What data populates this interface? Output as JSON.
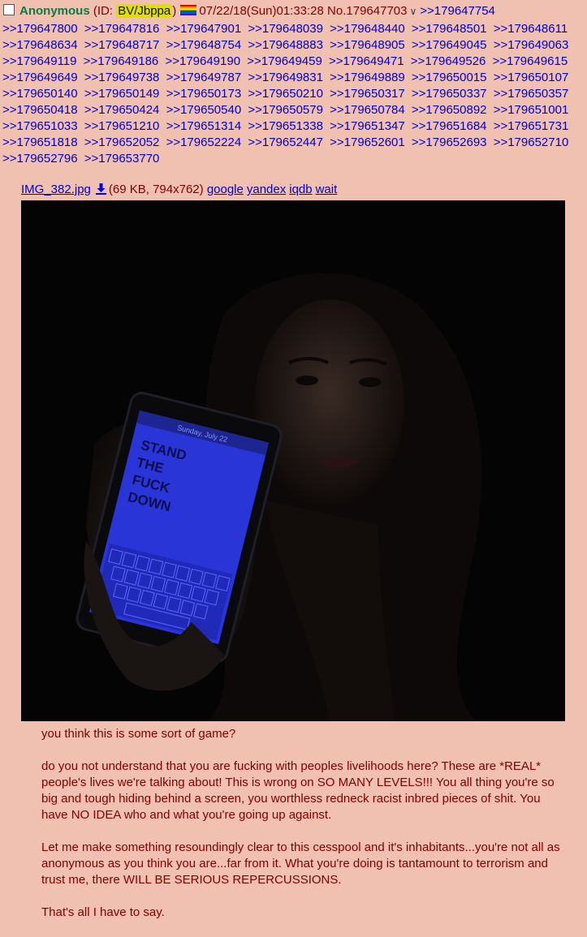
{
  "post": {
    "name": "Anonymous",
    "id_prefix": "(ID: ",
    "id_value": "BV/Jbppa",
    "id_suffix": ")",
    "datetime": "07/22/18(Sun)01:33:28",
    "post_no": "No.179647703",
    "replies": [
      ">>179647754",
      ">>179647800",
      ">>179647816",
      ">>179647901",
      ">>179648039",
      ">>179648440",
      ">>179648501",
      ">>179648611",
      ">>179648634",
      ">>179648717",
      ">>179648754",
      ">>179648883",
      ">>179648905",
      ">>179649045",
      ">>179649063",
      ">>179649119",
      ">>179649186",
      ">>179649190",
      ">>179649459",
      ">>179649471",
      ">>179649526",
      ">>179649615",
      ">>179649649",
      ">>179649738",
      ">>179649787",
      ">>179649831",
      ">>179649889",
      ">>179650015",
      ">>179650107",
      ">>179650140",
      ">>179650149",
      ">>179650173",
      ">>179650210",
      ">>179650317",
      ">>179650337",
      ">>179650357",
      ">>179650418",
      ">>179650424",
      ">>179650540",
      ">>179650579",
      ">>179650784",
      ">>179650892",
      ">>179651001",
      ">>179651033",
      ">>179651210",
      ">>179651314",
      ">>179651338",
      ">>179651347",
      ">>179651684",
      ">>179651731",
      ">>179651818",
      ">>179652052",
      ">>179652224",
      ">>179652447",
      ">>179652601",
      ">>179652693",
      ">>179652710",
      ">>179652796",
      ">>179653770"
    ],
    "file": {
      "name": "IMG_382.jpg",
      "meta": "(69 KB, 794x762)",
      "links": [
        "google",
        "yandex",
        "iqdb",
        "wait"
      ]
    },
    "image_text": [
      "STAND",
      "THE",
      "FUCK",
      "DOWN"
    ],
    "image_status": "Sunday, July 22",
    "comment": [
      "you think this is some sort of game?",
      "do you not understand that you are fucking with peoples livelihoods here? These are *REAL* people's lives we're talking about! This is wrong on SO MANY LEVELS!!! You all thing you're so big and tough hiding behind a screen, you worthless redneck racist inbred pieces of shit. You have NO IDEA who and what you're going up against.",
      "Let me make something resoundingly clear to this cesspool and it's inhabitants...you're not all as anonymous as you think you are...far from it. What you're doing is tantamount to terrorism and trust me, there WILL BE SERIOUS REPERCUSSIONS.",
      "That's all I have to say."
    ]
  },
  "colors": {
    "background": "#F0C0B0",
    "name": "#117743",
    "link": "#0000CC",
    "text": "#800000",
    "id_highlight": "#E0E000"
  },
  "icons": [
    "checkbox",
    "pride-flag-icon",
    "menu-arrow-icon",
    "download-icon"
  ]
}
